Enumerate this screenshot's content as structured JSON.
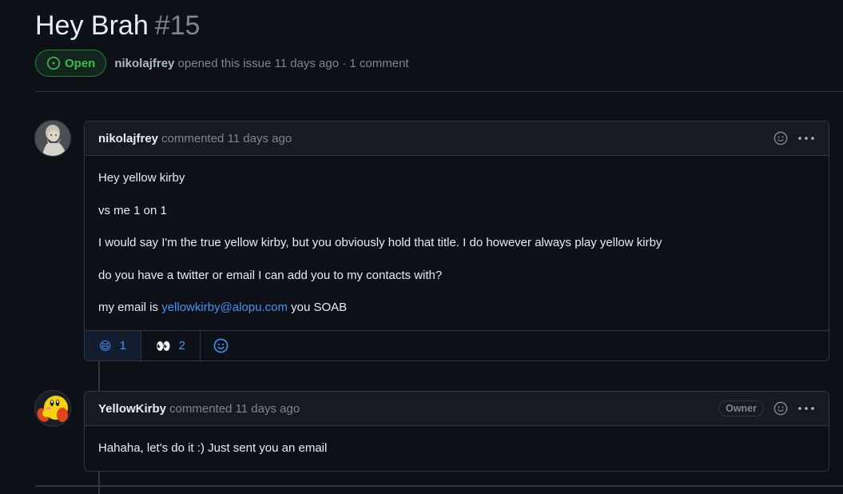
{
  "issue": {
    "title": "Hey Brah",
    "number": "#15",
    "state": "Open",
    "author": "nikolajfrey",
    "opened_text": "opened this issue 11 days ago · 1 comment"
  },
  "comments": [
    {
      "author": "nikolajfrey",
      "action": "commented 11 days ago",
      "avatar_icon": "wizard-avatar",
      "paragraphs": [
        "Hey yellow kirby",
        "vs me 1 on 1",
        "I would say I'm the true yellow kirby, but you obviously hold that title. I do however always play yellow kirby",
        "do you have a twitter or email I can add you to my contacts with?"
      ],
      "last_line": {
        "prefix": "my email is ",
        "link": "yellowkirby@alopu.com",
        "suffix": " you SOAB"
      },
      "reactions": [
        {
          "icon": "grinning-face-icon",
          "emoji": "😄",
          "count": "1"
        },
        {
          "icon": "eyes-icon",
          "emoji": "👀",
          "count": "2"
        }
      ]
    },
    {
      "author": "YellowKirby",
      "action": "commented 11 days ago",
      "avatar_icon": "kirby-avatar",
      "badge": "Owner",
      "paragraphs": [
        "Hahaha, let's do it :) Just sent you an email"
      ]
    }
  ],
  "colors": {
    "background": "#0d1117",
    "open_green": "#3fb950",
    "link_blue": "#4493f8",
    "border": "#30363d"
  }
}
